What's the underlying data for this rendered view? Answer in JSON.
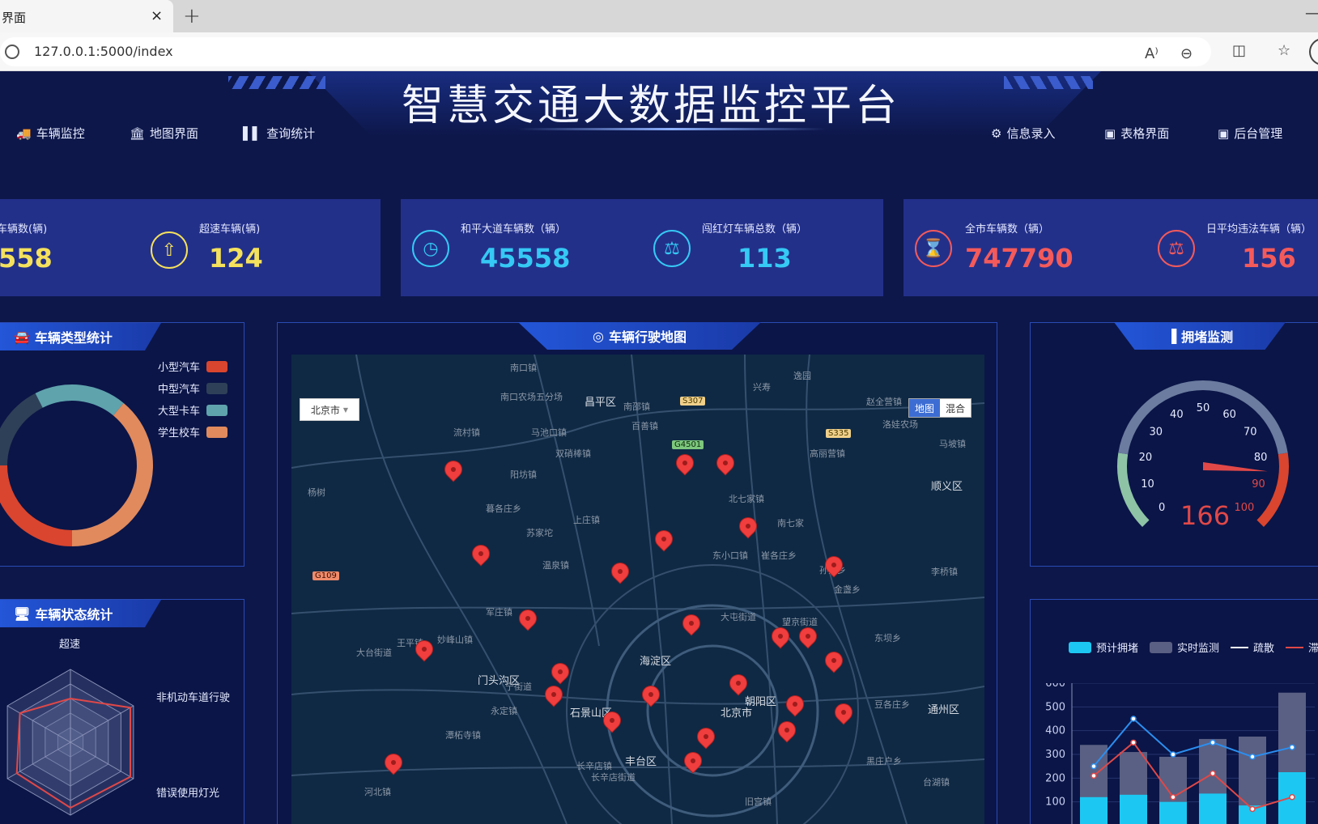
{
  "browser": {
    "tab_title": "界面",
    "url": "127.0.0.1:5000/index",
    "close_glyph": "×",
    "newtab_glyph": "+"
  },
  "header": {
    "title": "智慧交通大数据监控平台",
    "nav_left": [
      "车辆监控",
      "地图界面",
      "查询统计"
    ],
    "nav_right": [
      "信息录入",
      "表格界面",
      "后台管理"
    ]
  },
  "stats": [
    {
      "label": "车辆数(辆)",
      "value": "558",
      "color": "#f5e15c"
    },
    {
      "label": "超速车辆(辆)",
      "value": "124",
      "color": "#f5e15c"
    },
    {
      "label": "和平大道车辆数（辆）",
      "value": "45558",
      "color": "#35c9f5"
    },
    {
      "label": "闯红灯车辆总数（辆）",
      "value": "113",
      "color": "#35c9f5"
    },
    {
      "label": "全市车辆数（辆）",
      "value": "747790",
      "color": "#f45a5a"
    },
    {
      "label": "日平均违法车辆（辆）",
      "value": "156",
      "color": "#f45a5a"
    }
  ],
  "vehicle_type": {
    "title": "车辆类型统计",
    "legend": [
      {
        "name": "小型汽车",
        "color": "#d9452e"
      },
      {
        "name": "中型汽车",
        "color": "#2e4058"
      },
      {
        "name": "大型卡车",
        "color": "#5fa3ad"
      },
      {
        "name": "学生校车",
        "color": "#e08a5e"
      }
    ]
  },
  "vehicle_status": {
    "title": "车辆状态统计",
    "labels": [
      "超速",
      "非机动车道行驶",
      "错误使用灯光"
    ]
  },
  "map": {
    "title": "车辆行驶地图",
    "city_select": "北京市",
    "map_types": [
      "地图",
      "混合"
    ],
    "districts": [
      "顺义区",
      "海淀区",
      "朝阳区",
      "北京市",
      "门头沟区",
      "石景山区",
      "丰台区",
      "通州区",
      "昌平区"
    ],
    "places": [
      "南口镇",
      "南口农场五分场",
      "流村镇",
      "马池口镇",
      "阳坊镇",
      "暮各庄乡",
      "苏家坨",
      "上庄镇",
      "温泉镇",
      "军庄镇",
      "妙峰山镇",
      "王平镇",
      "大台街道",
      "永定镇",
      "潭柘寺镇",
      "宁街道",
      "长辛店镇",
      "河北镇",
      "杨树",
      "兴寿",
      "逸园",
      "赵全营镇",
      "洛娃农场",
      "马坡镇",
      "高丽营镇",
      "北七家镇",
      "东小口镇",
      "崔各庄乡",
      "孙河乡",
      "金盏乡",
      "大屯街道",
      "望京街道",
      "东坝乡",
      "豆各庄乡",
      "黑庄户乡",
      "台湖镇",
      "旧宫镇",
      "百善镇",
      "南邵镇",
      "长辛店街道",
      "双硝棒镇",
      "李桥镇",
      "南七家"
    ],
    "roads": [
      "S307",
      "G4501",
      "S335",
      "G109"
    ]
  },
  "congestion": {
    "title": "拥堵监测",
    "gauge_value": "166",
    "ticks": [
      "0",
      "10",
      "20",
      "30",
      "40",
      "50",
      "60",
      "70",
      "80",
      "90",
      "100"
    ]
  },
  "chart_data": {
    "type": "bar",
    "legend": [
      "预计拥堵",
      "实时监测",
      "疏散",
      "滞"
    ],
    "y_ticks": [
      100,
      200,
      300,
      400,
      500,
      600
    ],
    "ylim": [
      0,
      600
    ],
    "categories": [
      "",
      "",
      "",
      "",
      "",
      ""
    ],
    "series": [
      {
        "name": "预计拥堵",
        "values": [
          120,
          130,
          100,
          135,
          85,
          225
        ],
        "color": "#1cc8f2"
      },
      {
        "name": "实时监测",
        "values": [
          340,
          310,
          290,
          365,
          375,
          560
        ],
        "color": "#5a6083"
      },
      {
        "name": "疏散",
        "values": [
          250,
          450,
          300,
          350,
          290,
          330
        ],
        "color": "#2b8ef0"
      },
      {
        "name": "滞",
        "values": [
          210,
          350,
          120,
          220,
          70,
          120
        ],
        "color": "#e04848"
      }
    ],
    "colors": {
      "cyan": "#1cc8f2",
      "grey": "#5a6083",
      "blue": "#2b8ef0",
      "red": "#e04848"
    }
  }
}
